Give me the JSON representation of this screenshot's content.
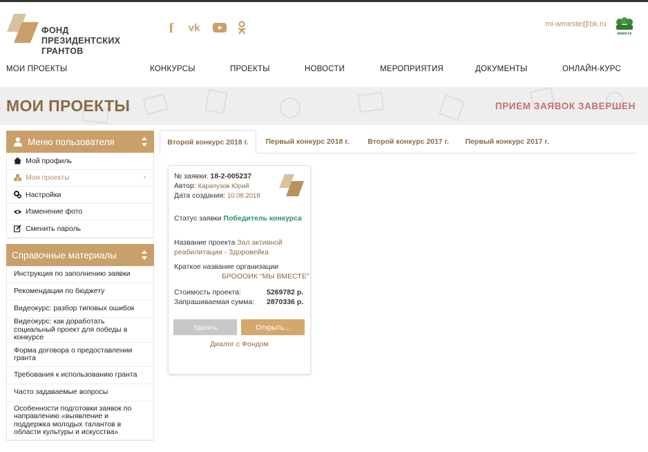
{
  "header": {
    "logo_lines": [
      "ФОНД",
      "ПРЕЗИДЕНТСКИХ",
      "ГРАНТОВ"
    ],
    "social": [
      {
        "icon": "facebook-icon",
        "glyph": "f"
      },
      {
        "icon": "vk-icon",
        "glyph": "vk"
      },
      {
        "icon": "youtube-icon",
        "glyph": "▶"
      },
      {
        "icon": "odnoklassniki-icon",
        "glyph": "ok"
      }
    ],
    "email": "mi-wmeste@bk.ru",
    "partner_logo_text": "вместе"
  },
  "nav": [
    "МОИ ПРОЕКТЫ",
    "КОНКУРСЫ",
    "ПРОЕКТЫ",
    "НОВОСТИ",
    "МЕРОПРИЯТИЯ",
    "ДОКУМЕНТЫ",
    "ОНЛАЙН-КУРС"
  ],
  "banner": {
    "title": "МОИ ПРОЕКТЫ",
    "status": "ПРИЕМ ЗАЯВОК ЗАВЕРШЕН"
  },
  "user_menu": {
    "title": "Меню пользователя",
    "items": [
      {
        "label": "Мой профиль",
        "icon": "home-icon"
      },
      {
        "label": "Мои проекты",
        "icon": "cubes-icon",
        "active": true
      },
      {
        "label": "Настройки",
        "icon": "gears-icon"
      },
      {
        "label": "Изменение фото",
        "icon": "eye-icon"
      },
      {
        "label": "Сменить пароль",
        "icon": "edit-icon"
      }
    ]
  },
  "ref_menu": {
    "title": "Справочные материалы",
    "items": [
      "Инструкция по заполнению заявки",
      "Рекомендации по бюджету",
      "Видеокурс: разбор типовых ошибок",
      "Видеокурс: как доработать социальный проект для победы в конкурсе",
      "Форма договора о предоставлении гранта",
      "Требования к использованию гранта",
      "Часто задаваемые вопросы",
      "Особенности подготовки заявок по направлению «выявление и поддержка молодых талантов в области культуры и искусства»"
    ]
  },
  "tabs": [
    "Второй конкурс 2018 г.",
    "Первый конкурс 2018 г.",
    "Второй конкурс 2017 г.",
    "Первый конкурс 2017 г."
  ],
  "card": {
    "number_label": "№ заявки:",
    "number": "18-2-005237",
    "author_label": "Автор:",
    "author": "Карапузов Юрий",
    "date_label": "Дата создания:",
    "date": "10.08.2018",
    "status_label": "Статус заявки",
    "status": "Победитель конкурса",
    "project_label": "Название проекта",
    "project_name_1": "Зал активной",
    "project_name_2": "реабилитации - Здоровейка",
    "org_label": "Краткое название организации",
    "org_name": "БРОООИК \"МЫ ВМЕСТЕ\"",
    "cost_label": "Стоимость проекта:",
    "cost": "5269782 р.",
    "requested_label": "Запрашиваемая сумма:",
    "requested": "2870336 р.",
    "delete_label": "Удалить",
    "open_label": "Открыть...",
    "dialog_label": "Диалог с Фондом"
  },
  "colors": {
    "accent": "#c9a06a",
    "brand_dark": "#8b6a44",
    "status_red": "#c57070",
    "status_green": "#2e8b7a"
  }
}
